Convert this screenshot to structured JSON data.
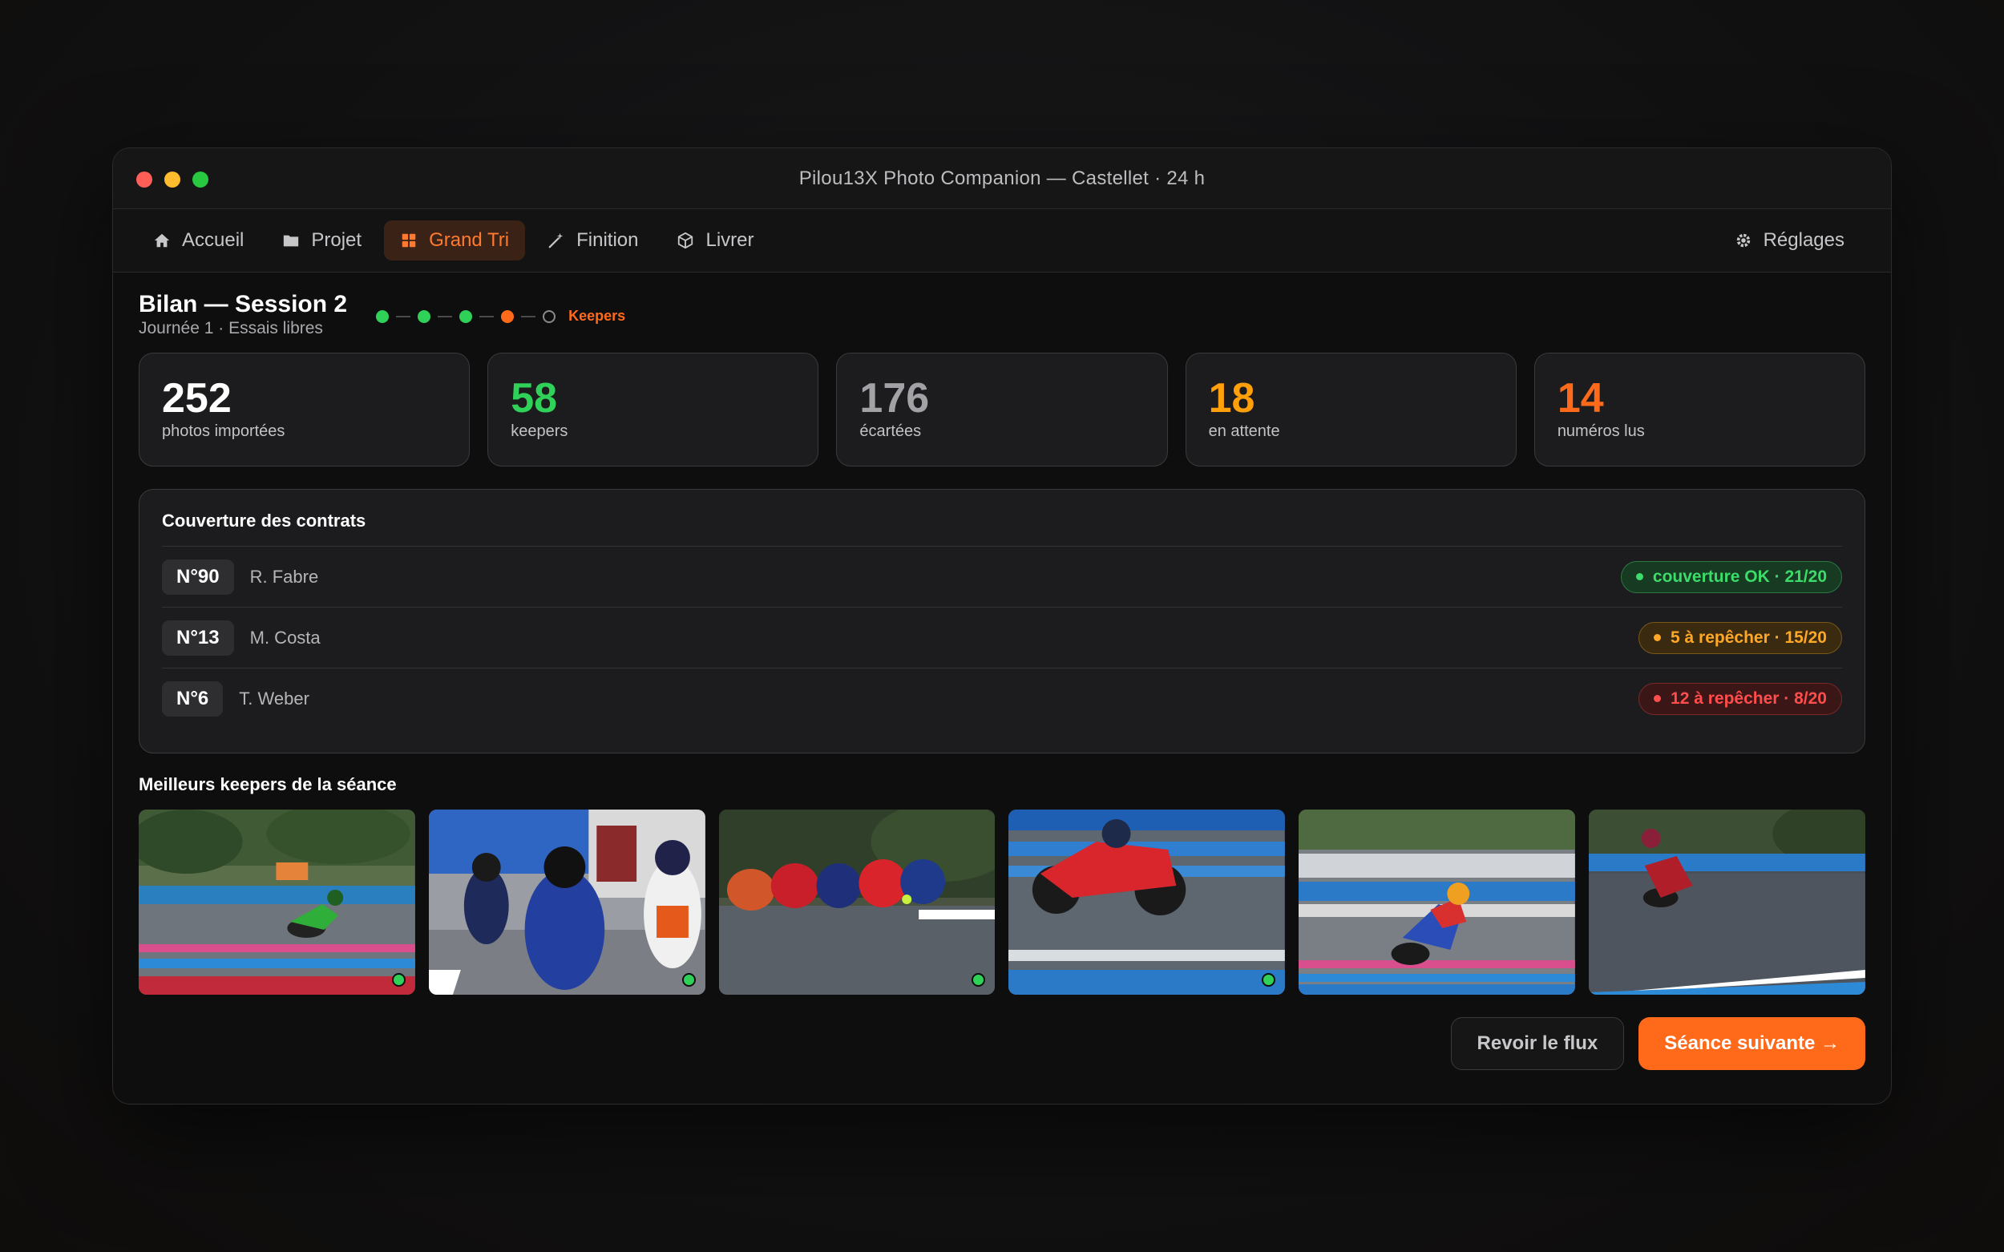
{
  "window": {
    "title": "Pilou13X Photo Companion — Castellet · 24 h"
  },
  "nav": {
    "items": [
      {
        "label": "Accueil",
        "icon": "home-icon"
      },
      {
        "label": "Projet",
        "icon": "folder-icon"
      },
      {
        "label": "Grand Tri",
        "icon": "grid-icon",
        "active": true
      },
      {
        "label": "Finition",
        "icon": "wand-icon"
      },
      {
        "label": "Livrer",
        "icon": "box-icon"
      }
    ],
    "settings": {
      "label": "Réglages",
      "icon": "gear-icon"
    }
  },
  "header": {
    "title": "Bilan — Session 2",
    "subtitle": "Journée 1 · Essais libres",
    "steps": [
      "done",
      "done",
      "done",
      "current",
      "todo"
    ],
    "current_step_label": "Keepers"
  },
  "stats": [
    {
      "value": "252",
      "label": "photos importées",
      "color": "#ffffff"
    },
    {
      "value": "58",
      "label": "keepers",
      "color": "#30d158"
    },
    {
      "value": "176",
      "label": "écartées",
      "color": "#a1a1a6"
    },
    {
      "value": "18",
      "label": "en attente",
      "color": "#ff9f0a"
    },
    {
      "value": "14",
      "label": "numéros lus",
      "color": "#ff6a1a"
    }
  ],
  "coverage": {
    "title": "Couverture des contrats",
    "rows": [
      {
        "number": "N°90",
        "rider": "R. Fabre",
        "status": "couverture OK · 21/20",
        "level": "ok"
      },
      {
        "number": "N°13",
        "rider": "M. Costa",
        "status": "5 à repêcher · 15/20",
        "level": "warn"
      },
      {
        "number": "N°6",
        "rider": "T. Weber",
        "status": "12 à repêcher · 8/20",
        "level": "bad"
      }
    ]
  },
  "keepers": {
    "title": "Meilleurs keepers de la séance",
    "photos": [
      {
        "scene": "green-bike-trees",
        "bike_color": "#2fae3a",
        "kept": true
      },
      {
        "scene": "pitlane-group",
        "bike_color": "#2a3fa8",
        "kept": true
      },
      {
        "scene": "pack-in-corner",
        "bike_color": "#d82a2a",
        "kept": true
      },
      {
        "scene": "red-bike-blue-stripes",
        "bike_color": "#d8262c",
        "kept": true
      },
      {
        "scene": "multicolor-bike-lean",
        "bike_color": "#c8302e",
        "kept": false
      },
      {
        "scene": "dark-bike-trees",
        "bike_color": "#b01e2a",
        "kept": false
      }
    ]
  },
  "actions": {
    "secondary": "Revoir le flux",
    "primary": "Séance suivante →"
  }
}
